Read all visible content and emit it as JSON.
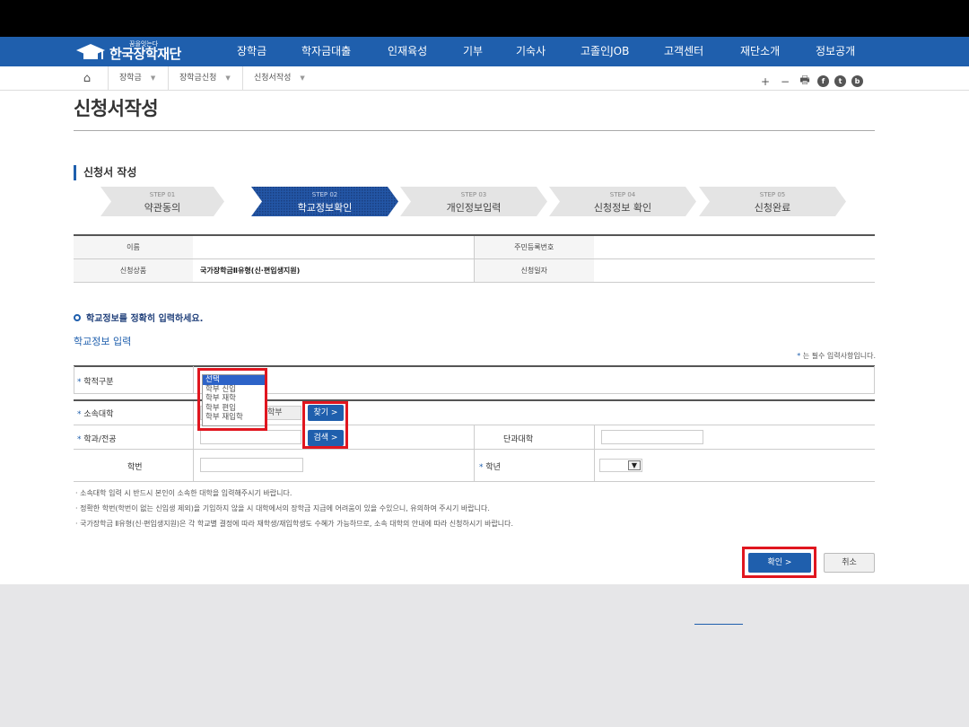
{
  "header": {
    "logo_small": "꿈을잇는다",
    "logo_text": "한국장학재단",
    "menu": [
      "장학금",
      "학자금대출",
      "인재육성",
      "기부",
      "기숙사",
      "고졸인JOB",
      "고객센터",
      "재단소개",
      "정보공개"
    ]
  },
  "breadcrumb": {
    "home_icon": "home-icon",
    "items": [
      "장학금",
      "장학금신청",
      "신청서작성"
    ]
  },
  "toolbar": {
    "zoom_in": "+",
    "zoom_out": "−",
    "print": "🖶",
    "facebook": "f",
    "twitter": "t",
    "blog": "b"
  },
  "page_title": "신청서작성",
  "section_title": "신청서 작성",
  "steps": [
    {
      "label": "STEP 01",
      "name": "약관동의",
      "active": false
    },
    {
      "label": "STEP 02",
      "name": "학교정보확인",
      "active": true
    },
    {
      "label": "STEP 03",
      "name": "개인정보입력",
      "active": false
    },
    {
      "label": "STEP 04",
      "name": "신청정보 확인",
      "active": false
    },
    {
      "label": "STEP 05",
      "name": "신청완료",
      "active": false
    }
  ],
  "info_table": {
    "name_label": "이름",
    "name_value": "",
    "rrn_label": "주민등록번호",
    "rrn_value": "",
    "product_label": "신청상품",
    "product_value": "국가장학금Ⅱ유형(신·편입생지원)",
    "date_label": "신청일자",
    "date_value": ""
  },
  "notice": "학교정보를 정확히 입력하세요.",
  "school_section_label": "학교정보 입력",
  "required_note": "는 필수 입력사항입니다.",
  "form": {
    "status_label": "학적구분",
    "status_options": [
      "선택",
      "학부 신입",
      "학부 재학",
      "학부 편입",
      "학부 재입학"
    ],
    "status_selected_index": 0,
    "university_label": "소속대학",
    "university_value": "학부",
    "find_button": "찾기 >",
    "dept_label": "학과/전공",
    "search_button": "검색 >",
    "college_label": "단과대학",
    "student_id_label": "학번",
    "grade_label": "학년"
  },
  "notes": [
    "· 소속대학 입력 시 반드시 본인이 소속한 대학을 입력해주시기 바랍니다.",
    "· 정확한 학번(학번이 없는 신입생 제외)을 기입하지 않을 시 대학에서의 장학금 지급에 어려움이 있을 수있으니, 유의하여 주시기 바랍니다.",
    "· 국가장학금 Ⅱ유형(신·편입생지원)은 각 학교별 결정에 따라 재학생/재입학생도 수혜가 가능하므로, 소속 대학의 안내에 따라 신청하시기 바랍니다."
  ],
  "buttons": {
    "ok": "확인  >",
    "cancel": "취소"
  },
  "colors": {
    "primary": "#1f5fad",
    "highlight": "#e0161f"
  }
}
